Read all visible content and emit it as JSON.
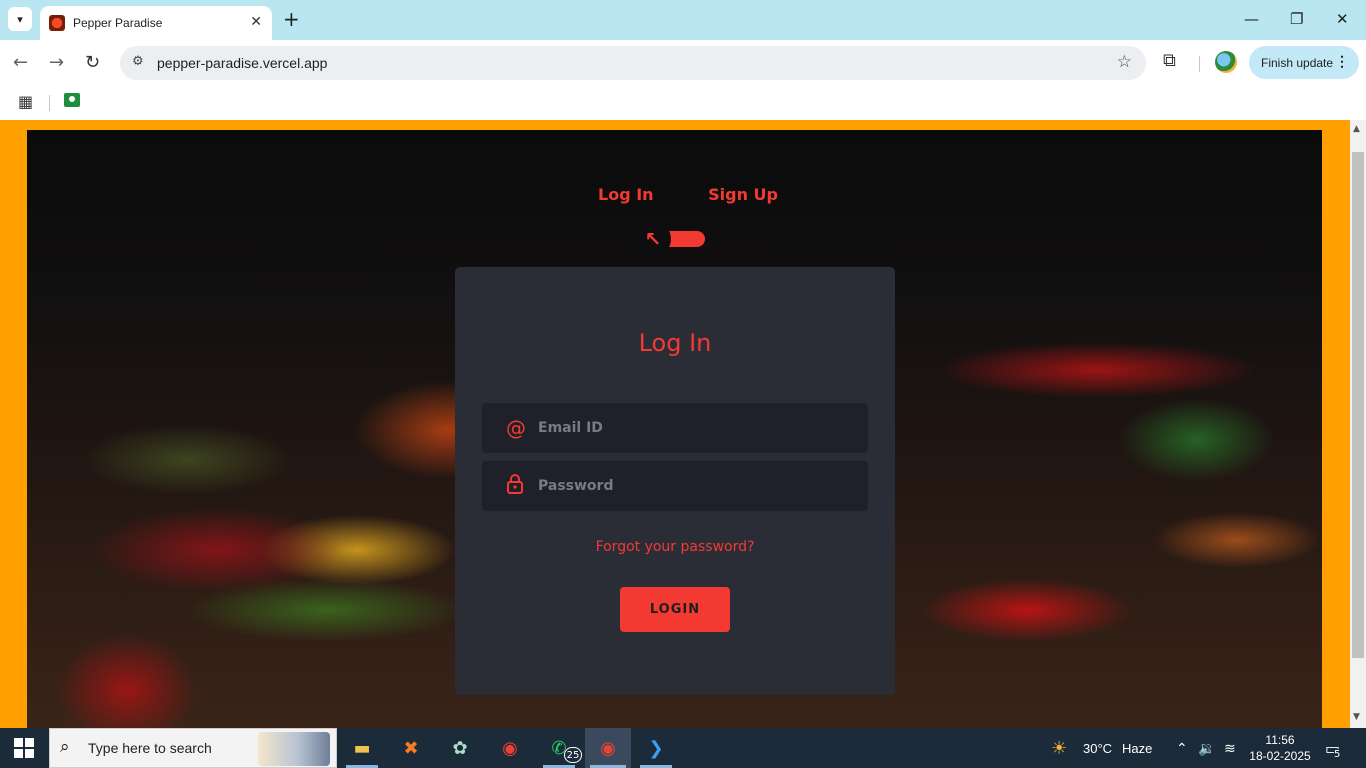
{
  "browser": {
    "tab_title": "Pepper Paradise",
    "url": "pepper-paradise.vercel.app",
    "finish_update_label": "Finish update"
  },
  "page": {
    "switch_login_label": "Log In",
    "switch_signup_label": "Sign Up",
    "card_title": "Log In",
    "email_placeholder": "Email ID",
    "password_placeholder": "Password",
    "forgot_label": "Forgot your password?",
    "login_button_label": "LOGIN",
    "accent_color": "#f23a33"
  },
  "taskbar": {
    "search_placeholder": "Type here to search",
    "whatsapp_badge": "25",
    "weather_temp": "30°C",
    "weather_desc": "Haze",
    "time": "11:56",
    "date": "18-02-2025",
    "notification_count": "5"
  }
}
